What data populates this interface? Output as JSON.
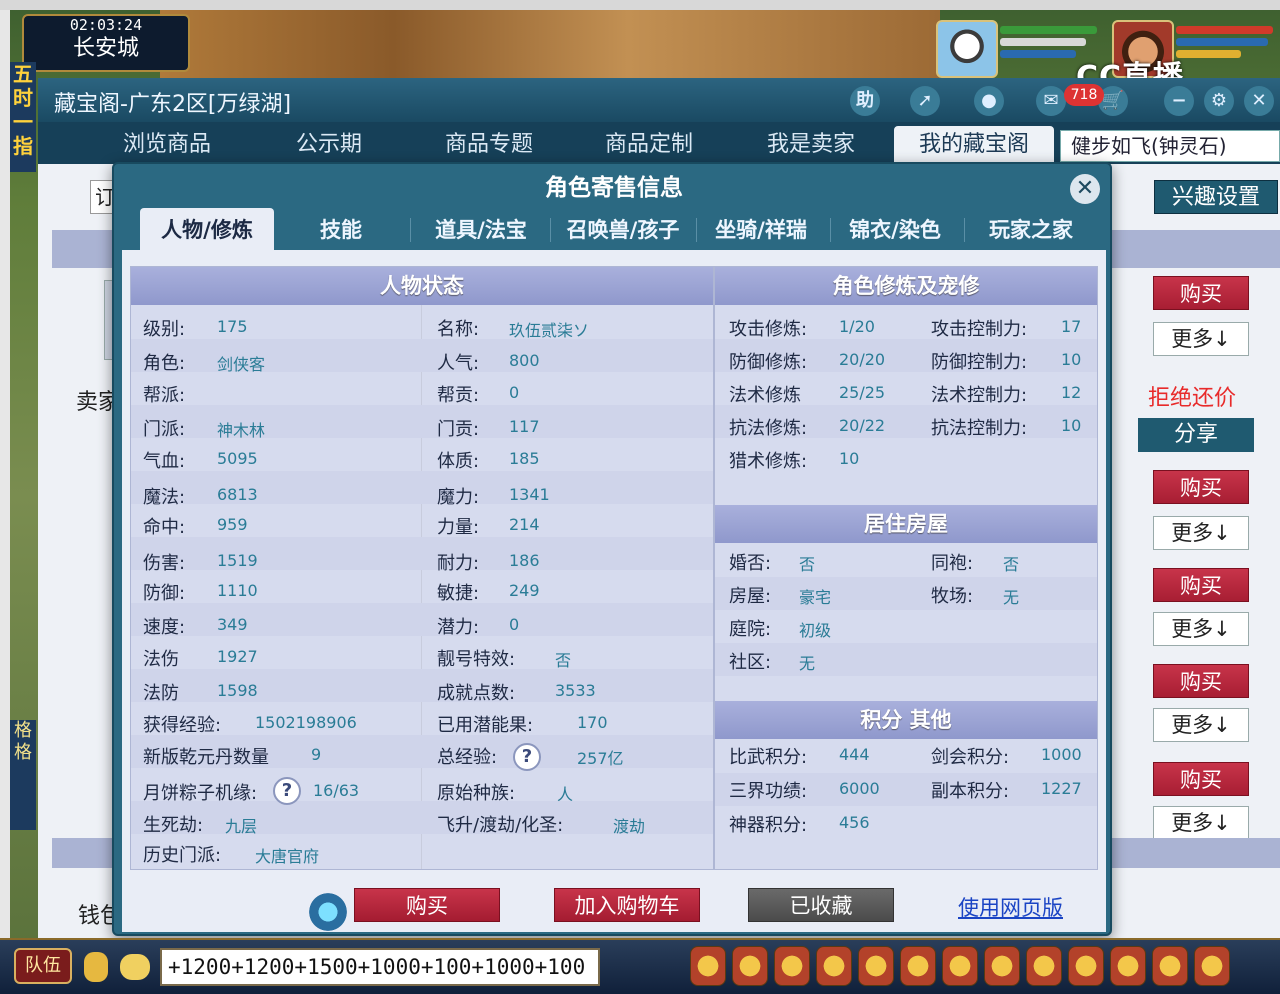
{
  "game": {
    "clock": "02:03:24",
    "city": "长安城",
    "side_left": "五时一指",
    "side_left2": "格格",
    "chat_input": "+1200+1200+1500+1000+100+1000+100",
    "team_label": "队伍",
    "stream_logo": "CC直播"
  },
  "store": {
    "title": "藏宝阁-广东2区[万绿湖]",
    "notif_count": "718",
    "icons": [
      "help-icon",
      "share-icon",
      "stop-icon",
      "chat-icon",
      "cart-icon",
      "minimize-icon",
      "settings-icon",
      "close-icon"
    ],
    "help_glyph": "助",
    "tabs": [
      "浏览商品",
      "公示期",
      "商品专题",
      "商品定制",
      "我是卖家",
      "我的藏宝阁"
    ],
    "active_tab": "我的藏宝阁",
    "search_value": "健步如飞(钟灵石)",
    "filter_glyph": "订",
    "interest_label": "兴趣设置",
    "seller_label": "卖家",
    "money_label": "钱包",
    "refuse_label": "拒绝还价",
    "share_label": "分享",
    "buy_label": "购买",
    "more_label": "更多↓"
  },
  "modal": {
    "title": "角色寄售信息",
    "tabs": [
      "人物/修炼",
      "技能",
      "道具/法宝",
      "召唤兽/孩子",
      "坐骑/祥瑞",
      "锦衣/染色",
      "玩家之家"
    ],
    "active_tab": "人物/修炼",
    "sections": {
      "status": "人物状态",
      "cultivation": "角色修炼及宠修",
      "housing": "居住房屋",
      "points": "积分 其他"
    },
    "left_col": [
      {
        "label": "级别:",
        "value": "175"
      },
      {
        "label": "角色:",
        "value": "剑侠客"
      },
      {
        "label": "帮派:",
        "value": ""
      },
      {
        "label": "门派:",
        "value": "神木林"
      },
      {
        "label": "气血:",
        "value": "5095"
      },
      {
        "label": "魔法:",
        "value": "6813"
      },
      {
        "label": "命中:",
        "value": "959"
      },
      {
        "label": "伤害:",
        "value": "1519"
      },
      {
        "label": "防御:",
        "value": "1110"
      },
      {
        "label": "速度:",
        "value": "349"
      },
      {
        "label": "法伤",
        "value": "1927"
      },
      {
        "label": "法防",
        "value": "1598"
      },
      {
        "label": "获得经验:",
        "value": "1502198906"
      },
      {
        "label": "新版乾元丹数量",
        "value": "9"
      },
      {
        "label": "月饼粽子机缘:",
        "value": "16/63"
      },
      {
        "label": "生死劫:",
        "value": "九层"
      },
      {
        "label": "历史门派:",
        "value": "大唐官府"
      }
    ],
    "mid_col": [
      {
        "label": "名称:",
        "value": "玖伍贰柒ソ"
      },
      {
        "label": "人气:",
        "value": "800"
      },
      {
        "label": "帮贡:",
        "value": "0"
      },
      {
        "label": "门贡:",
        "value": "117"
      },
      {
        "label": "体质:",
        "value": "185"
      },
      {
        "label": "魔力:",
        "value": "1341"
      },
      {
        "label": "力量:",
        "value": "214"
      },
      {
        "label": "耐力:",
        "value": "186"
      },
      {
        "label": "敏捷:",
        "value": "249"
      },
      {
        "label": "潜力:",
        "value": "0"
      },
      {
        "label": "靓号特效:",
        "value": "否"
      },
      {
        "label": "成就点数:",
        "value": "3533"
      },
      {
        "label": "已用潜能果:",
        "value": "170"
      },
      {
        "label": "总经验:",
        "value": "257亿"
      },
      {
        "label": "原始种族:",
        "value": "人"
      },
      {
        "label": "飞升/渡劫/化圣:",
        "value": "渡劫"
      }
    ],
    "cultivation": [
      {
        "l1": "攻击修炼:",
        "v1": "1/20",
        "l2": "攻击控制力:",
        "v2": "17"
      },
      {
        "l1": "防御修炼:",
        "v1": "20/20",
        "l2": "防御控制力:",
        "v2": "10"
      },
      {
        "l1": "法术修炼",
        "v1": "25/25",
        "l2": "法术控制力:",
        "v2": "12"
      },
      {
        "l1": "抗法修炼:",
        "v1": "20/22",
        "l2": "抗法控制力:",
        "v2": "10"
      },
      {
        "l1": "猎术修炼:",
        "v1": "10",
        "l2": "",
        "v2": ""
      }
    ],
    "housing": [
      {
        "l1": "婚否:",
        "v1": "否",
        "l2": "同袍:",
        "v2": "否"
      },
      {
        "l1": "房屋:",
        "v1": "豪宅",
        "l2": "牧场:",
        "v2": "无"
      },
      {
        "l1": "庭院:",
        "v1": "初级",
        "l2": "",
        "v2": ""
      },
      {
        "l1": "社区:",
        "v1": "无",
        "l2": "",
        "v2": ""
      }
    ],
    "points": [
      {
        "l1": "比武积分:",
        "v1": "444",
        "l2": "剑会积分:",
        "v2": "1000"
      },
      {
        "l1": "三界功绩:",
        "v1": "6000",
        "l2": "副本积分:",
        "v2": "1227"
      },
      {
        "l1": "神器积分:",
        "v1": "456",
        "l2": "",
        "v2": ""
      }
    ],
    "help_glyph": "?",
    "actions": {
      "buy": "购买",
      "add_cart": "加入购物车",
      "saved": "已收藏",
      "web": "使用网页版"
    }
  }
}
